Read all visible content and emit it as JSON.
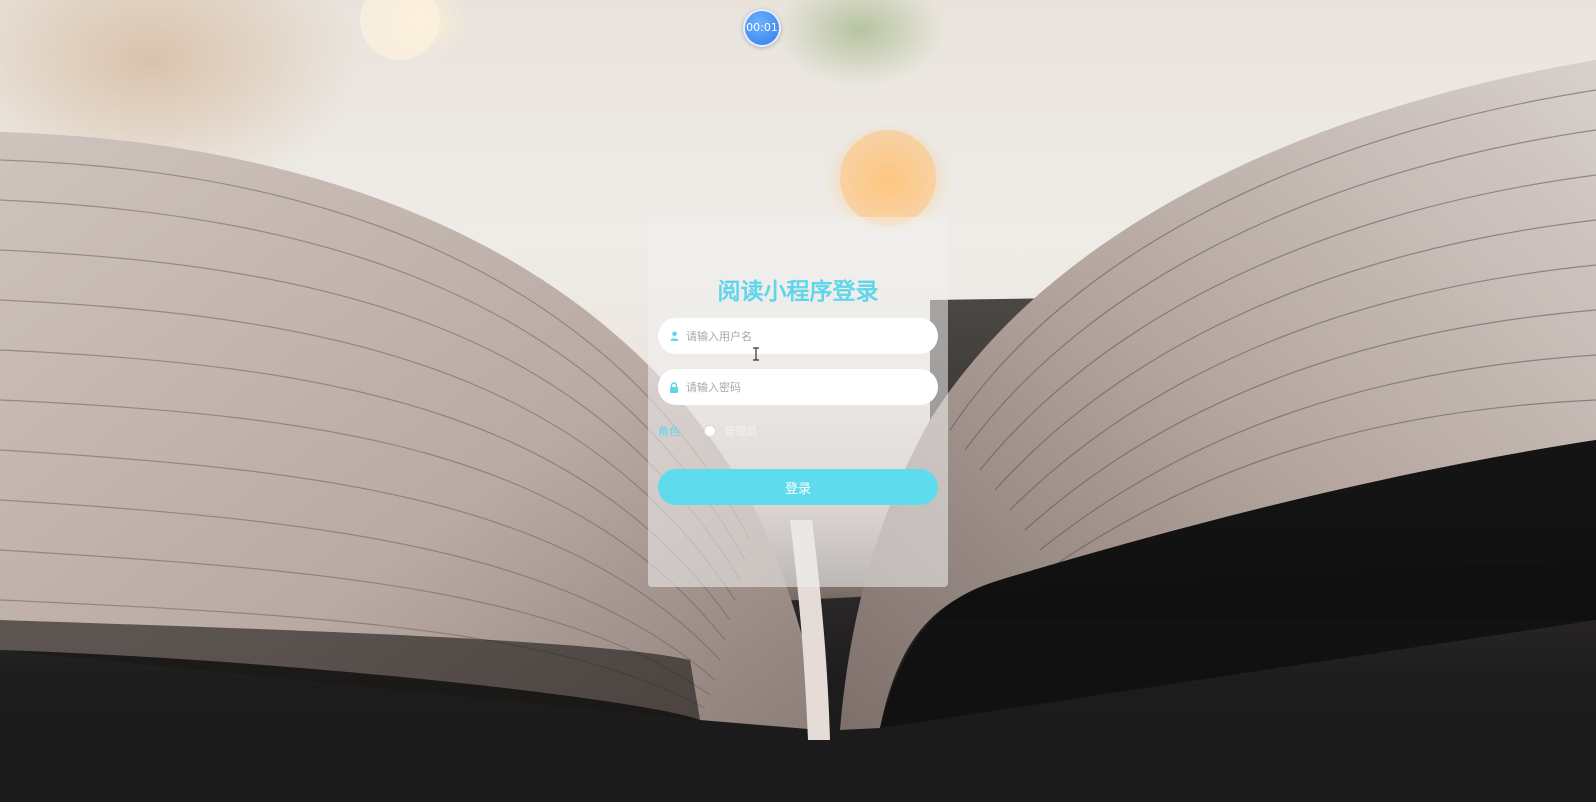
{
  "timer": {
    "text": "00:01"
  },
  "login": {
    "title": "阅读小程序登录",
    "username_placeholder": "请输入用户名",
    "password_placeholder": "请输入密码",
    "role_label": "角色",
    "role_options": [
      "管理员"
    ],
    "submit_label": "登录"
  },
  "colors": {
    "accent": "#5fd6ea",
    "button": "#5fdbee",
    "timer": "#3a8cf0"
  },
  "icons": {
    "username": "user-icon",
    "password": "lock-icon",
    "cursor": "text-cursor-icon"
  }
}
